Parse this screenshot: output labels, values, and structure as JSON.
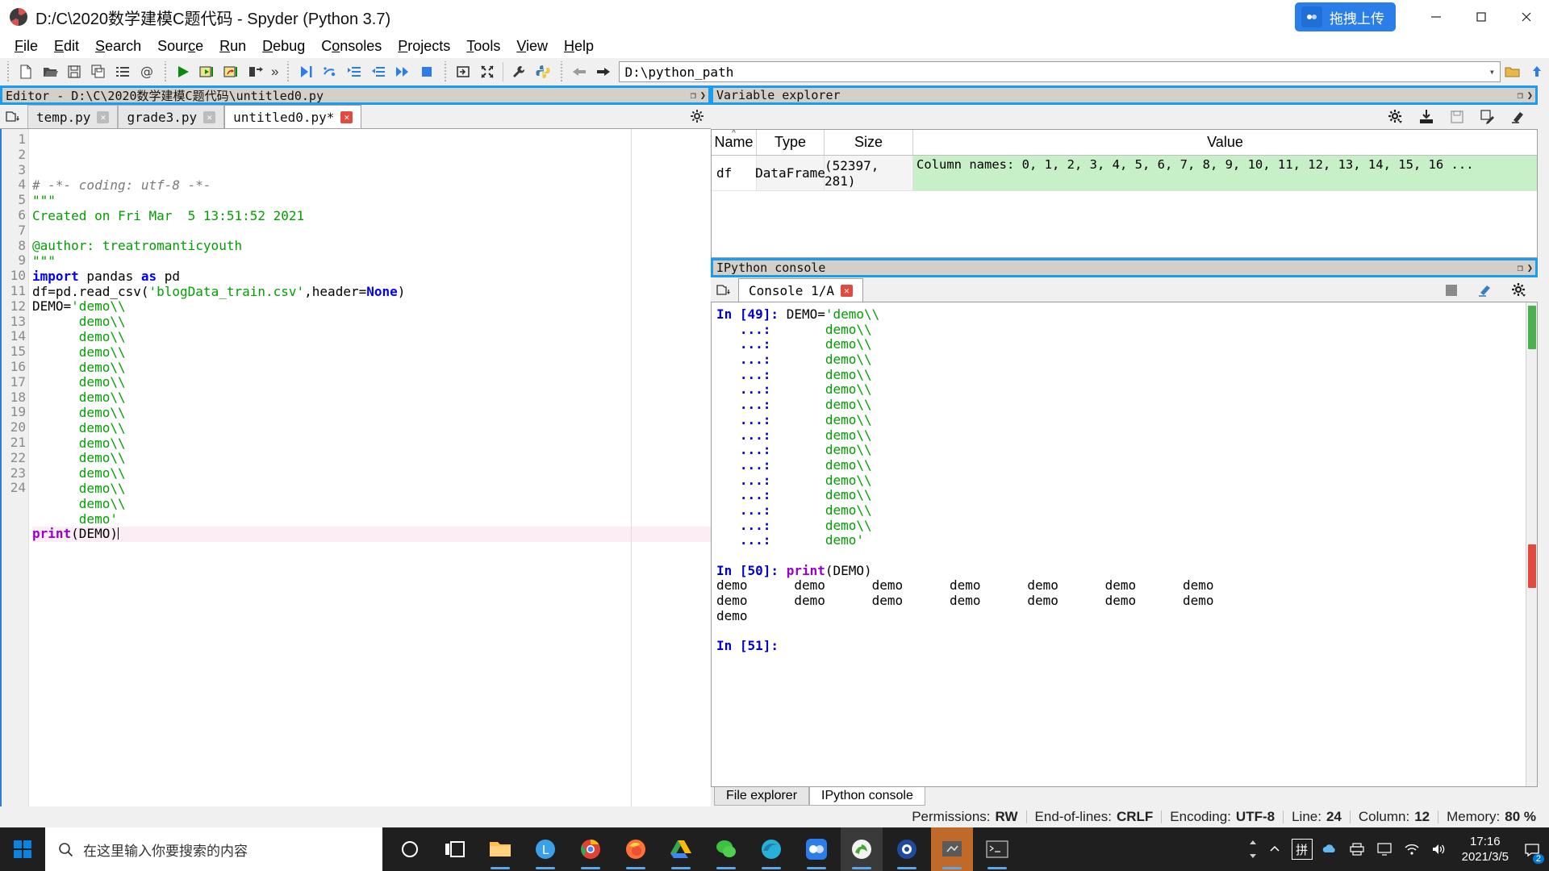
{
  "window": {
    "title": "D:/C\\2020数学建模C题代码 - Spyder (Python 3.7)",
    "app_icon": "spyder-icon",
    "upload_button": "拖拽上传",
    "minimize": "minimize-icon",
    "maximize": "maximize-icon",
    "close": "close-icon"
  },
  "menubar": {
    "items": [
      {
        "label": "File",
        "mnemonic": "F"
      },
      {
        "label": "Edit",
        "mnemonic": "E"
      },
      {
        "label": "Search",
        "mnemonic": "S"
      },
      {
        "label": "Source",
        "mnemonic": "c"
      },
      {
        "label": "Run",
        "mnemonic": "R"
      },
      {
        "label": "Debug",
        "mnemonic": "D"
      },
      {
        "label": "Consoles",
        "mnemonic": "o"
      },
      {
        "label": "Projects",
        "mnemonic": "P"
      },
      {
        "label": "Tools",
        "mnemonic": "T"
      },
      {
        "label": "View",
        "mnemonic": "V"
      },
      {
        "label": "Help",
        "mnemonic": "H"
      }
    ]
  },
  "toolbar": {
    "groups": [
      [
        "new-file-icon",
        "open-file-icon",
        "save-file-icon",
        "save-all-icon",
        "file-list-icon",
        "at-sign-icon"
      ],
      [
        "run-icon",
        "run-cell-icon",
        "run-cell-advance-icon",
        "run-selection-icon",
        "overflow-icon"
      ],
      [
        "debug-icon",
        "step-over-icon",
        "step-into-icon",
        "step-return-icon",
        "continue-icon",
        "stop-debug-icon"
      ],
      [
        "maximize-pane-icon",
        "fullscreen-icon"
      ],
      [
        "preferences-icon",
        "pythonpath-manager-icon"
      ],
      [
        "back-icon",
        "forward-icon"
      ]
    ],
    "path_value": "D:\\python_path",
    "path_dropdown": "chevron-down-icon",
    "open_dir_icon": "open-dir-icon",
    "parent_dir_icon": "parent-dir-icon"
  },
  "editor_panel": {
    "title": "Editor - D:\\C\\2020数学建模C题代码\\untitled0.py",
    "undock_icon": "undock-icon",
    "close_icon": "close-pane-icon",
    "browse_tabs_icon": "browse-tabs-icon",
    "options_icon": "options-gear-icon",
    "tabs": [
      {
        "label": "temp.py",
        "active": false,
        "modified": false
      },
      {
        "label": "grade3.py",
        "active": false,
        "modified": false
      },
      {
        "label": "untitled0.py*",
        "active": true,
        "modified": true
      }
    ],
    "code_lines": [
      {
        "n": 1,
        "tokens": [
          {
            "t": "# -*- coding: utf-8 -*-",
            "c": "com"
          }
        ]
      },
      {
        "n": 2,
        "tokens": [
          {
            "t": "\"\"\"",
            "c": "str"
          }
        ]
      },
      {
        "n": 3,
        "tokens": [
          {
            "t": "Created on Fri Mar  5 13:51:52 2021",
            "c": "str"
          }
        ]
      },
      {
        "n": 4,
        "tokens": [
          {
            "t": "",
            "c": "str"
          }
        ]
      },
      {
        "n": 5,
        "tokens": [
          {
            "t": "@author: treatromanticyouth",
            "c": "str"
          }
        ]
      },
      {
        "n": 6,
        "tokens": [
          {
            "t": "\"\"\"",
            "c": "str"
          }
        ]
      },
      {
        "n": 7,
        "tokens": [
          {
            "t": "import",
            "c": "kw"
          },
          {
            "t": " pandas ",
            "c": "plain"
          },
          {
            "t": "as",
            "c": "kw"
          },
          {
            "t": " pd",
            "c": "plain"
          }
        ]
      },
      {
        "n": 8,
        "tokens": [
          {
            "t": "df=pd.read_csv(",
            "c": "plain"
          },
          {
            "t": "'blogData_train.csv'",
            "c": "str"
          },
          {
            "t": ",header=",
            "c": "plain"
          },
          {
            "t": "None",
            "c": "kw"
          },
          {
            "t": ")",
            "c": "plain"
          }
        ]
      },
      {
        "n": 9,
        "tokens": [
          {
            "t": "DEMO=",
            "c": "plain"
          },
          {
            "t": "'demo\\\\",
            "c": "str"
          }
        ]
      },
      {
        "n": 10,
        "tokens": [
          {
            "t": "      demo\\\\",
            "c": "str"
          }
        ]
      },
      {
        "n": 11,
        "tokens": [
          {
            "t": "      demo\\\\",
            "c": "str"
          }
        ]
      },
      {
        "n": 12,
        "tokens": [
          {
            "t": "      demo\\\\",
            "c": "str"
          }
        ]
      },
      {
        "n": 13,
        "tokens": [
          {
            "t": "      demo\\\\",
            "c": "str"
          }
        ]
      },
      {
        "n": 14,
        "tokens": [
          {
            "t": "      demo\\\\",
            "c": "str"
          }
        ]
      },
      {
        "n": 15,
        "tokens": [
          {
            "t": "      demo\\\\",
            "c": "str"
          }
        ]
      },
      {
        "n": 16,
        "tokens": [
          {
            "t": "      demo\\\\",
            "c": "str"
          }
        ]
      },
      {
        "n": 17,
        "tokens": [
          {
            "t": "      demo\\\\",
            "c": "str"
          }
        ]
      },
      {
        "n": 18,
        "tokens": [
          {
            "t": "      demo\\\\",
            "c": "str"
          }
        ]
      },
      {
        "n": 19,
        "tokens": [
          {
            "t": "      demo\\\\",
            "c": "str"
          }
        ]
      },
      {
        "n": 20,
        "tokens": [
          {
            "t": "      demo\\\\",
            "c": "str"
          }
        ]
      },
      {
        "n": 21,
        "tokens": [
          {
            "t": "      demo\\\\",
            "c": "str"
          }
        ]
      },
      {
        "n": 22,
        "tokens": [
          {
            "t": "      demo\\\\",
            "c": "str"
          }
        ]
      },
      {
        "n": 23,
        "tokens": [
          {
            "t": "      demo'",
            "c": "str"
          }
        ]
      },
      {
        "n": 24,
        "tokens": [
          {
            "t": "print",
            "c": "def"
          },
          {
            "t": "(DEMO)",
            "c": "plain"
          }
        ],
        "current": true
      }
    ]
  },
  "variable_explorer": {
    "title": "Variable explorer",
    "undock_icon": "undock-icon",
    "close_icon": "close-pane-icon",
    "toolbar_icons": [
      "options-gear-icon",
      "import-data-icon",
      "save-data-icon",
      "save-data-as-icon",
      "remove-all-icon"
    ],
    "columns": [
      "Name",
      "Type",
      "Size",
      "Value"
    ],
    "sort_indicator": "sort-asc-caret",
    "rows": [
      {
        "name": "df",
        "type": "DataFrame",
        "size": "(52397, 281)",
        "value": "Column names: 0, 1, 2, 3, 4, 5, 6, 7, 8, 9, 10, 11, 12, 13, 14, 15, 16 ..."
      }
    ]
  },
  "ipython_panel": {
    "title": "IPython console",
    "undock_icon": "undock-icon",
    "close_icon": "close-pane-icon",
    "browse_tabs_icon": "browse-tabs-icon",
    "tabs": [
      {
        "label": "Console 1/A",
        "active": true
      }
    ],
    "tool_icons": [
      "stop-icon",
      "remove-all-icon",
      "options-gear-icon"
    ],
    "lines": [
      {
        "prompt": "In [49]:",
        "code": "DEMO=",
        "str": "'demo\\\\",
        "kind": "in"
      },
      {
        "prompt": "   ...:",
        "str": "      demo\\\\",
        "kind": "cont"
      },
      {
        "prompt": "   ...:",
        "str": "      demo\\\\",
        "kind": "cont"
      },
      {
        "prompt": "   ...:",
        "str": "      demo\\\\",
        "kind": "cont"
      },
      {
        "prompt": "   ...:",
        "str": "      demo\\\\",
        "kind": "cont"
      },
      {
        "prompt": "   ...:",
        "str": "      demo\\\\",
        "kind": "cont"
      },
      {
        "prompt": "   ...:",
        "str": "      demo\\\\",
        "kind": "cont"
      },
      {
        "prompt": "   ...:",
        "str": "      demo\\\\",
        "kind": "cont"
      },
      {
        "prompt": "   ...:",
        "str": "      demo\\\\",
        "kind": "cont"
      },
      {
        "prompt": "   ...:",
        "str": "      demo\\\\",
        "kind": "cont"
      },
      {
        "prompt": "   ...:",
        "str": "      demo\\\\",
        "kind": "cont"
      },
      {
        "prompt": "   ...:",
        "str": "      demo\\\\",
        "kind": "cont"
      },
      {
        "prompt": "   ...:",
        "str": "      demo\\\\",
        "kind": "cont"
      },
      {
        "prompt": "   ...:",
        "str": "      demo\\\\",
        "kind": "cont"
      },
      {
        "prompt": "   ...:",
        "str": "      demo\\\\",
        "kind": "cont"
      },
      {
        "prompt": "   ...:",
        "str": "      demo'",
        "kind": "cont"
      },
      {
        "kind": "blank"
      },
      {
        "prompt": "In [50]:",
        "fn": "print",
        "code": "(DEMO)",
        "kind": "in-call"
      },
      {
        "out": "demo      demo      demo      demo      demo      demo      demo",
        "kind": "out"
      },
      {
        "out": "demo      demo      demo      demo      demo      demo      demo",
        "kind": "out"
      },
      {
        "out": "demo",
        "kind": "out"
      },
      {
        "kind": "blank"
      },
      {
        "prompt": "In [51]:",
        "kind": "in-empty"
      }
    ],
    "bottom_tabs": [
      {
        "label": "File explorer",
        "active": false
      },
      {
        "label": "IPython console",
        "active": true
      }
    ]
  },
  "statusbar": {
    "items": [
      {
        "label": "Permissions:",
        "value": "RW"
      },
      {
        "label": "End-of-lines:",
        "value": "CRLF"
      },
      {
        "label": "Encoding:",
        "value": "UTF-8"
      },
      {
        "label": "Line:",
        "value": "24"
      },
      {
        "label": "Column:",
        "value": "12"
      },
      {
        "label": "Memory:",
        "value": "80 %"
      }
    ]
  },
  "taskbar": {
    "start_icon": "windows-start-icon",
    "search_icon": "search-icon",
    "search_placeholder": "在这里输入你要搜索的内容",
    "task_view_icons": [
      "cortana-circle-icon",
      "task-view-icon"
    ],
    "apps": [
      {
        "name": "file-explorer-icon",
        "color": "#ffc04d",
        "running": true
      },
      {
        "name": "line-app-icon",
        "color": "#3aa0e8",
        "running": true
      },
      {
        "name": "chrome-icon",
        "color": "#e34133",
        "running": true
      },
      {
        "name": "firefox-icon",
        "color": "#ff7139",
        "running": true
      },
      {
        "name": "drive-icon",
        "color": "#fbbc05",
        "running": true
      },
      {
        "name": "wechat-icon",
        "color": "#3ec13e",
        "running": true
      },
      {
        "name": "edge-icon",
        "color": "#27b0da",
        "running": true
      },
      {
        "name": "tencent-meeting-icon",
        "color": "#2b7de9",
        "running": true
      },
      {
        "name": "anaconda-icon",
        "color": "#44a833",
        "running": true
      },
      {
        "name": "photos-icon",
        "color": "#1f4aa0",
        "running": true
      },
      {
        "name": "spyder-icon",
        "color": "#8b4513",
        "running": true,
        "active": true
      },
      {
        "name": "terminal-icon",
        "color": "#2b2b2b",
        "running": true
      }
    ],
    "tray": {
      "expand_icon": "chevron-up-icon",
      "ime_label": "拼",
      "icons": [
        "onedrive-icon",
        "printer-icon",
        "monitor-icon",
        "wifi-icon",
        "volume-icon"
      ],
      "time": "17:16",
      "date": "2021/3/5",
      "notification_icon": "action-center-icon",
      "notification_count": "2"
    }
  }
}
